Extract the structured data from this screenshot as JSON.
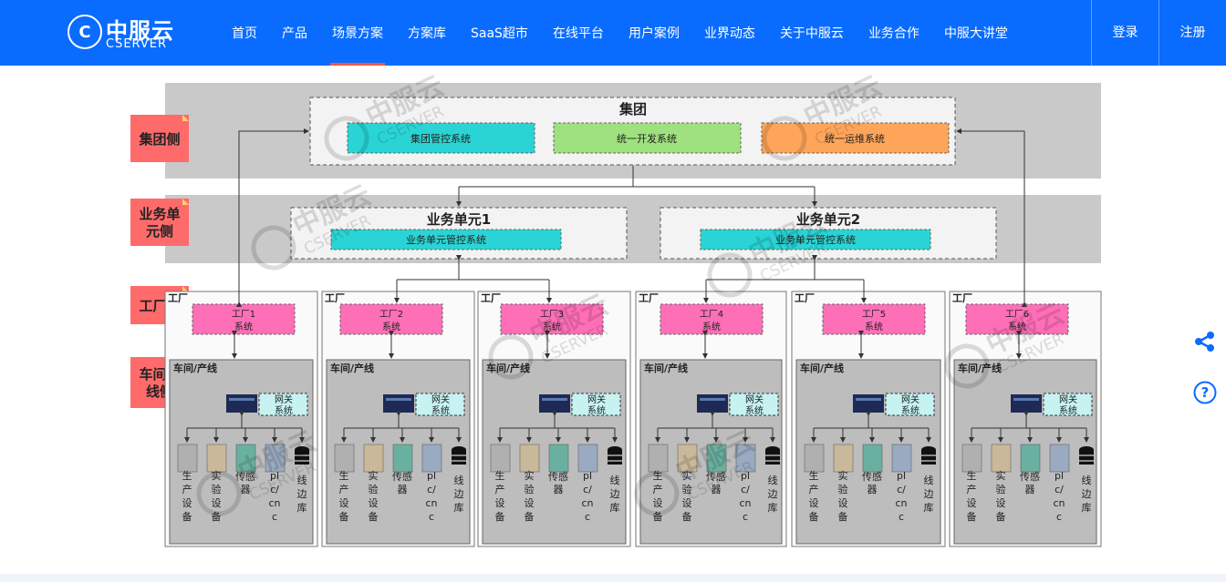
{
  "brand": {
    "name_cn": "中服云",
    "name_en": "CSERVER",
    "mark": "C"
  },
  "nav": {
    "items": [
      {
        "label": "首页"
      },
      {
        "label": "产品"
      },
      {
        "label": "场景方案",
        "active": true
      },
      {
        "label": "方案库"
      },
      {
        "label": "SaaS超市"
      },
      {
        "label": "在线平台"
      },
      {
        "label": "用户案例"
      },
      {
        "label": "业界动态"
      },
      {
        "label": "关于中服云"
      },
      {
        "label": "业务合作"
      },
      {
        "label": "中服大讲堂"
      }
    ],
    "login": "登录",
    "register": "注册"
  },
  "side": {
    "share_icon": "share-icon",
    "help_icon": "help-icon",
    "help_glyph": "?"
  },
  "diagram": {
    "levels": [
      "集团侧",
      "业务单元侧",
      "工厂侧",
      "车间产线侧"
    ],
    "group": {
      "title": "集团",
      "systems": [
        {
          "label": "集团管控系统",
          "color": "#2ad4d4"
        },
        {
          "label": "统一开发系统",
          "color": "#9fe07f"
        },
        {
          "label": "统一运维系统",
          "color": "#ffa55a"
        }
      ]
    },
    "units": [
      {
        "title": "业务单元1",
        "system": "业务单元管控系统"
      },
      {
        "title": "业务单元2",
        "system": "业务单元管控系统"
      }
    ],
    "factory_tag": "工厂",
    "factories": [
      {
        "name": "工厂1",
        "system": "系统"
      },
      {
        "name": "工厂2",
        "system": "系统"
      },
      {
        "name": "工厂3",
        "system": "系统"
      },
      {
        "name": "工厂4",
        "system": "系统"
      },
      {
        "name": "工厂5",
        "system": "系统"
      },
      {
        "name": "工厂6",
        "system": "系统"
      }
    ],
    "workshop_label": "车间/产线",
    "gateway": [
      "网关",
      "系统"
    ],
    "devices": [
      {
        "lines": [
          "生",
          "产",
          "设",
          "备"
        ]
      },
      {
        "lines": [
          "实",
          "验",
          "设",
          "备"
        ]
      },
      {
        "lines": [
          "传感",
          "器"
        ]
      },
      {
        "lines": [
          "pl",
          "c/",
          "cn",
          "c"
        ]
      },
      {
        "lines": [
          "线",
          "边",
          "库"
        ]
      }
    ],
    "colors": {
      "factory_system": "#ff6fb8",
      "unit_system": "#2ad4d4",
      "band": "#c9c9c9",
      "label_tag": "#ff6b6b"
    }
  }
}
